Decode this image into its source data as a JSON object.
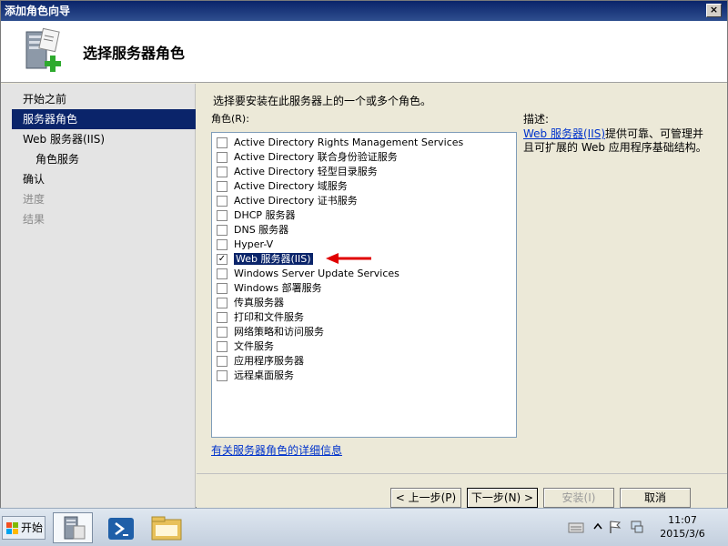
{
  "window": {
    "title": "添加角色向导",
    "close_label": "×"
  },
  "header": {
    "title": "选择服务器角色"
  },
  "nav": {
    "items": [
      {
        "label": "开始之前"
      },
      {
        "label": "服务器角色"
      },
      {
        "label": "Web 服务器(IIS)"
      },
      {
        "label": "角色服务"
      },
      {
        "label": "确认"
      },
      {
        "label": "进度"
      },
      {
        "label": "结果"
      }
    ]
  },
  "content": {
    "instruction": "选择要安装在此服务器上的一个或多个角色。",
    "roles_label": "角色(R):",
    "roles": [
      {
        "label": "Active Directory Rights Management Services",
        "checked": false
      },
      {
        "label": "Active Directory 联合身份验证服务",
        "checked": false
      },
      {
        "label": "Active Directory 轻型目录服务",
        "checked": false
      },
      {
        "label": "Active Directory 域服务",
        "checked": false
      },
      {
        "label": "Active Directory 证书服务",
        "checked": false
      },
      {
        "label": "DHCP 服务器",
        "checked": false
      },
      {
        "label": "DNS 服务器",
        "checked": false
      },
      {
        "label": "Hyper-V",
        "checked": false
      },
      {
        "label": "Web 服务器(IIS)",
        "checked": true,
        "selected": true
      },
      {
        "label": "Windows Server Update Services",
        "checked": false
      },
      {
        "label": "Windows 部署服务",
        "checked": false
      },
      {
        "label": "传真服务器",
        "checked": false
      },
      {
        "label": "打印和文件服务",
        "checked": false
      },
      {
        "label": "网络策略和访问服务",
        "checked": false
      },
      {
        "label": "文件服务",
        "checked": false
      },
      {
        "label": "应用程序服务器",
        "checked": false
      },
      {
        "label": "远程桌面服务",
        "checked": false
      }
    ],
    "details_link": "有关服务器角色的详细信息",
    "description_label": "描述:",
    "description_link": "Web 服务器(IIS)",
    "description_text": "提供可靠、可管理并且可扩展的 Web 应用程序基础结构。"
  },
  "buttons": {
    "prev": "< 上一步(P)",
    "next": "下一步(N) >",
    "install": "安装(I)",
    "cancel": "取消"
  },
  "taskbar": {
    "start_label": "开始",
    "time": "11:07",
    "date": "2015/3/6"
  },
  "colors": {
    "selection": "#0a246a",
    "arrow": "#e00000",
    "link": "#0033cc"
  }
}
